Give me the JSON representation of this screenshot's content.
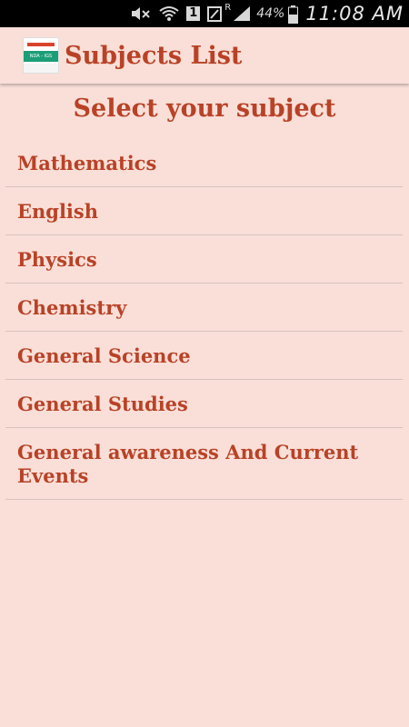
{
  "status_bar": {
    "icons": [
      "mute-icon",
      "wifi-icon",
      "sim-icon",
      "signal-icon",
      "battery-icon"
    ],
    "sim_slot": "1",
    "roaming": "R",
    "battery": "44%",
    "time": "11:08 AM"
  },
  "action_bar": {
    "logo_text": "NDA - IGS",
    "title": "Subjects List"
  },
  "main": {
    "heading": "Select your subject",
    "subjects": [
      "Mathematics",
      "English",
      "Physics",
      "Chemistry",
      "General Science",
      "General Studies",
      "General awareness And Current Events"
    ]
  },
  "colors": {
    "background": "#f9dfd8",
    "accent": "#b94226",
    "divider": "#d6c3be",
    "status_bar": "#000000"
  }
}
